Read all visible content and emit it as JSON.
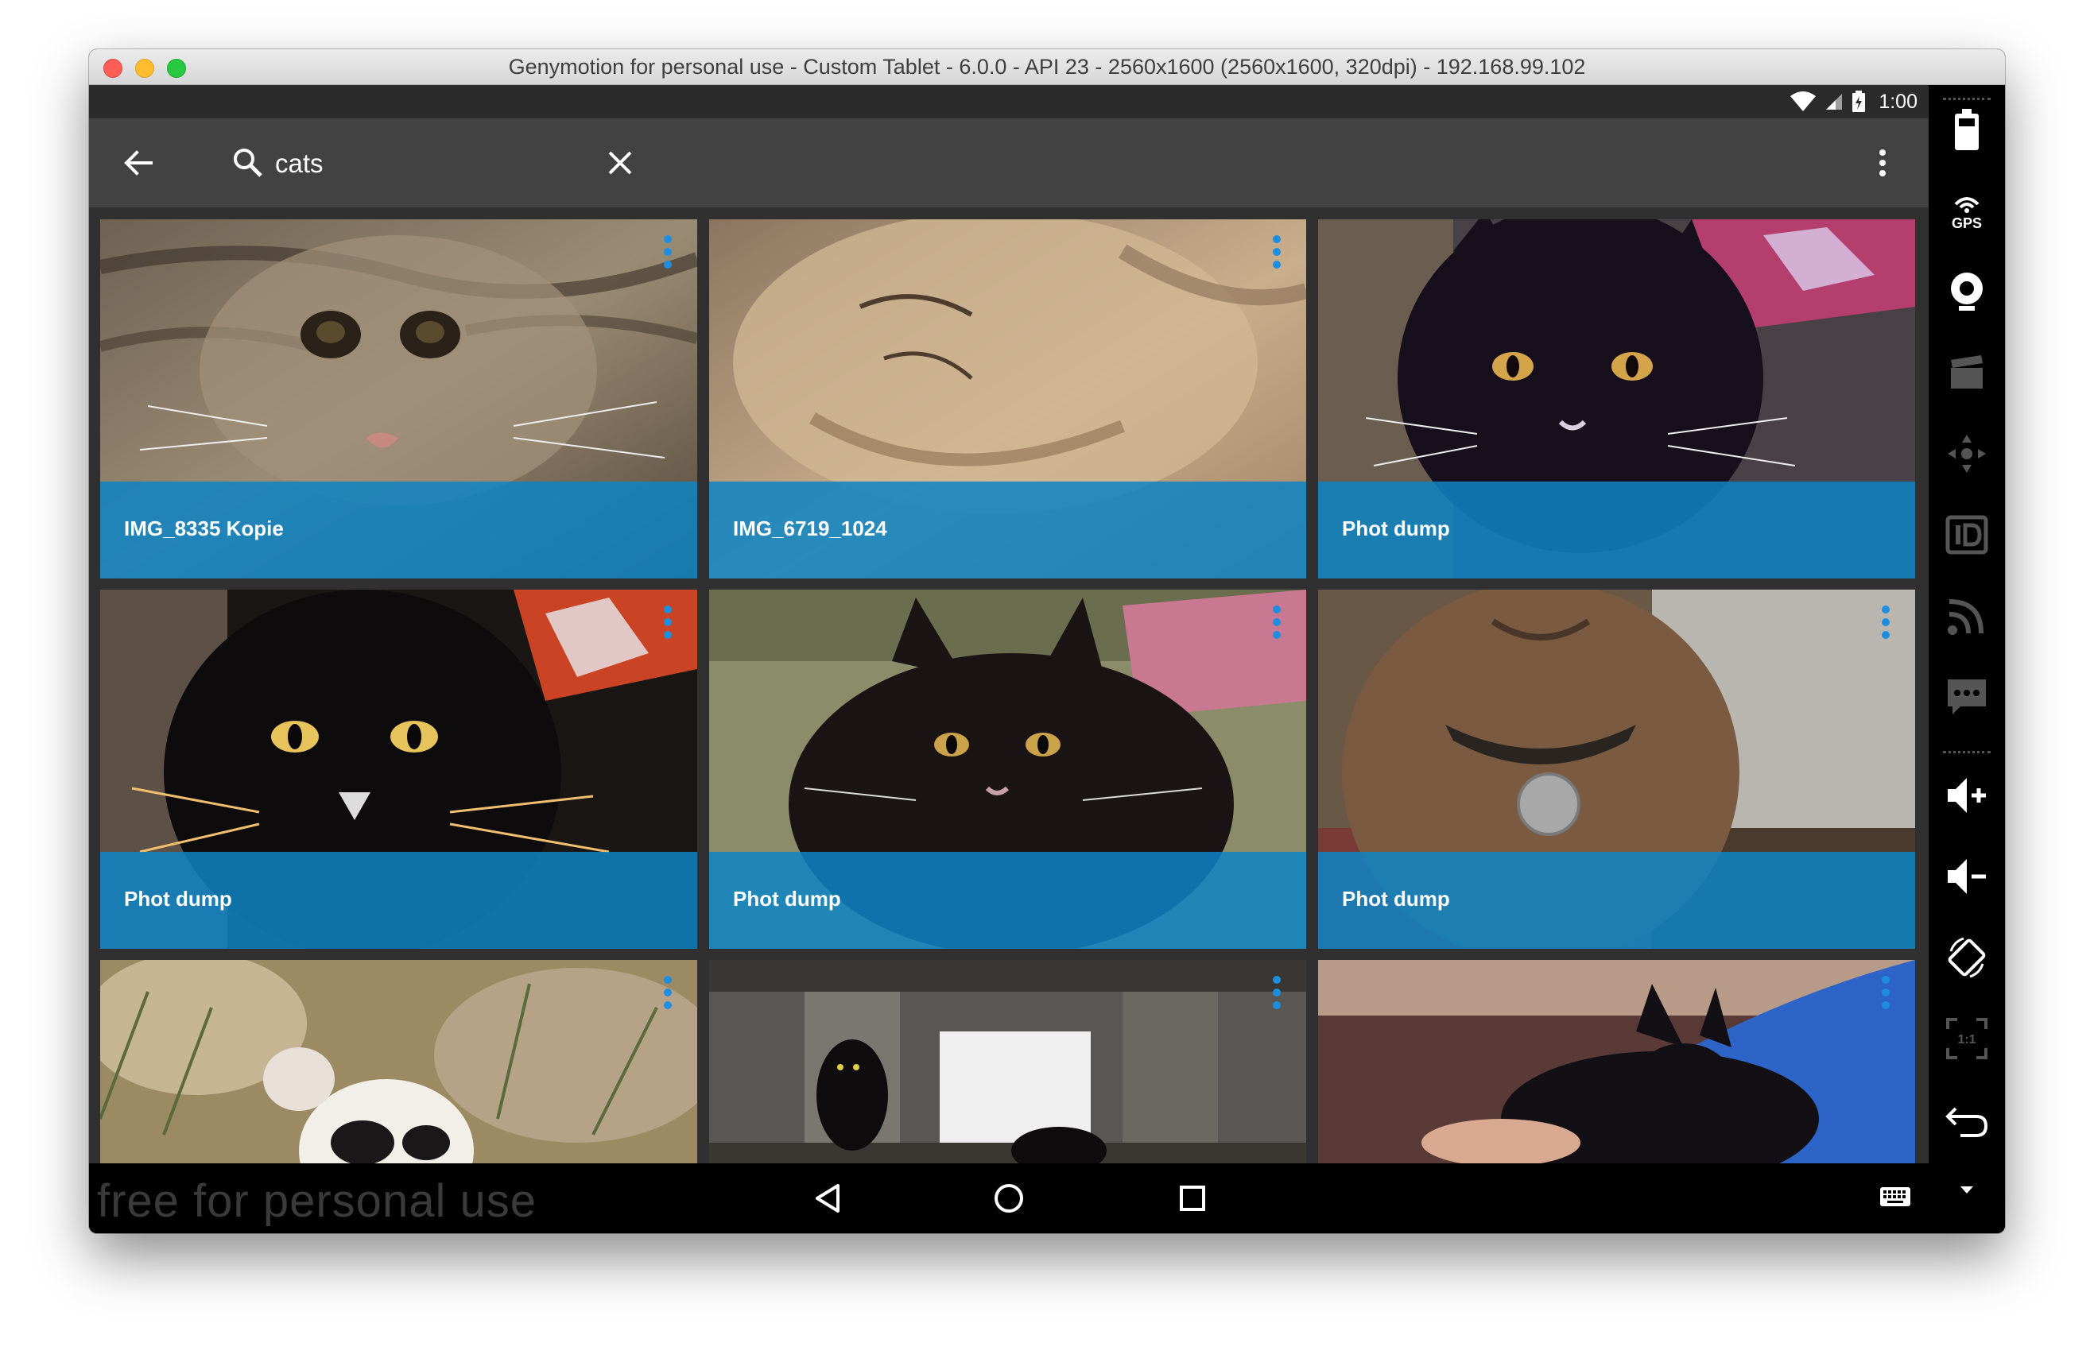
{
  "window": {
    "title": "Genymotion for personal use - Custom Tablet - 6.0.0 - API 23 - 2560x1600 (2560x1600, 320dpi) - 192.168.99.102"
  },
  "status_bar": {
    "time": "1:00",
    "icons": [
      "wifi-icon",
      "cell-signal-icon",
      "battery-charging-icon"
    ]
  },
  "app_bar": {
    "back_icon": "arrow-back-icon",
    "search_icon": "search-icon",
    "search_value": "cats",
    "clear_icon": "close-icon",
    "overflow_icon": "more-vertical-icon"
  },
  "results": [
    {
      "title": "IMG_8335 Kopie",
      "image": "tabby-cat-closeup"
    },
    {
      "title": "IMG_6719_1024",
      "image": "ginger-cat-sleeping"
    },
    {
      "title": "Phot dump",
      "image": "black-cat-on-pillow"
    },
    {
      "title": "Phot dump",
      "image": "black-cat-stylized"
    },
    {
      "title": "Phot dump",
      "image": "black-cat-on-couch"
    },
    {
      "title": "Phot dump",
      "image": "brown-cat-birdie-tag"
    },
    {
      "title": "",
      "image": "cat-in-grass"
    },
    {
      "title": "",
      "image": "black-cats-under-bridge"
    },
    {
      "title": "",
      "image": "black-cat-on-sofa"
    }
  ],
  "nav_bar": {
    "watermark": "free for personal use",
    "buttons": [
      "back-triangle-icon",
      "home-circle-icon",
      "recents-square-icon"
    ],
    "keyboard_icon": "keyboard-icon"
  },
  "emulator_toolbar": {
    "items": [
      "battery-icon",
      "gps-icon",
      "webcam-icon",
      "screencast-icon",
      "dpad-icon",
      "device-id-icon",
      "network-icon",
      "sms-icon",
      "volume-up-icon",
      "volume-down-icon",
      "rotate-icon",
      "pixel-perfect-icon",
      "back-icon",
      "expand-down-icon"
    ],
    "gps_label": "GPS",
    "pixel_label": "1:1"
  },
  "colors": {
    "caption": "#0e84c4",
    "app_bar": "#424242",
    "status_bar": "#2b2b2b",
    "accent_menu": "#1e8fe0"
  }
}
